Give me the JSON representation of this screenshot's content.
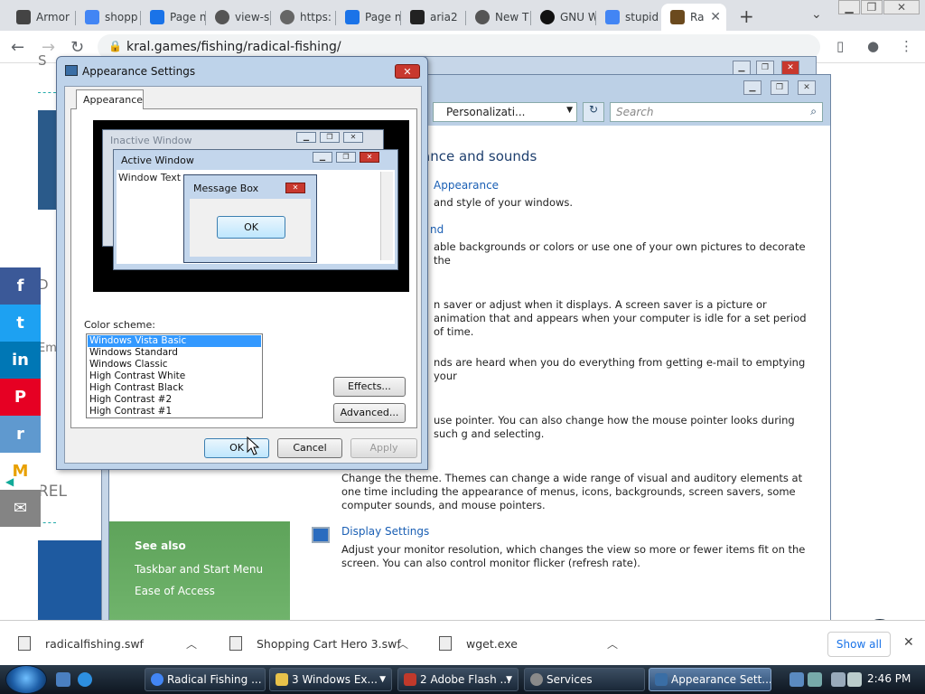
{
  "browser": {
    "tabs": [
      {
        "title": "Armor",
        "color": "#444"
      },
      {
        "title": "shopp",
        "color": "#4285f4"
      },
      {
        "title": "Page n",
        "color": "#1a73e8"
      },
      {
        "title": "view-s",
        "color": "#555"
      },
      {
        "title": "https:",
        "color": "#666"
      },
      {
        "title": "Page n",
        "color": "#1a73e8"
      },
      {
        "title": "aria2",
        "color": "#222"
      },
      {
        "title": "New T",
        "color": "#555"
      },
      {
        "title": "GNU W",
        "color": "#111"
      },
      {
        "title": "stupid",
        "color": "#4285f4"
      },
      {
        "title": "Ra",
        "color": "#6b4a1e",
        "active": true
      }
    ],
    "url": "kral.games/fishing/radical-fishing/"
  },
  "page": {
    "letter_s": "S",
    "letter_d": "D",
    "em_text": "Em",
    "rel_text": "REL",
    "social": [
      {
        "label": "f",
        "color": "#3b5998"
      },
      {
        "label": "t",
        "color": "#1da1f2"
      },
      {
        "label": "in",
        "color": "#0077b5"
      },
      {
        "label": "P",
        "color": "#e60023"
      },
      {
        "label": "r",
        "color": "#5f99cf"
      },
      {
        "label": "M",
        "color": "#ffffff"
      },
      {
        "label": "✉",
        "color": "#848484"
      }
    ]
  },
  "control_panel": {
    "address": "Personalizati...",
    "search_placeholder": "Search",
    "heading": "ance and sounds",
    "link_appearance": "Appearance",
    "text_appearance": "and style of your windows.",
    "link_desktop": "nd",
    "text_desktop": "able backgrounds or colors or use one of your own pictures to decorate the",
    "text_screensaver": "n saver or adjust when it displays. A screen saver is a picture or animation that and appears when your computer is idle for a set period of time.",
    "text_sounds": "nds are heard when you do everything from getting e-mail to emptying your",
    "text_mouse": "use pointer. You can also change how the mouse pointer looks during such g and selecting.",
    "text_theme": "Change the theme. Themes can change a wide range of visual and auditory elements at one time including the appearance of menus, icons, backgrounds, screen savers, some computer sounds, and mouse pointers.",
    "link_display": "Display Settings",
    "text_display": "Adjust your monitor resolution, which changes the view so more or fewer items fit on the screen. You can also control monitor flicker (refresh rate).",
    "see_also": "See also",
    "see_also_items": [
      "Taskbar and Start Menu",
      "Ease of Access"
    ]
  },
  "dialog": {
    "title": "Appearance Settings",
    "tab": "Appearance",
    "preview": {
      "inactive": "Inactive Window",
      "active": "Active Window",
      "window_text": "Window Text",
      "message_box": "Message Box",
      "ok": "OK"
    },
    "scheme_label": "Color scheme:",
    "schemes": [
      "Windows Vista Basic",
      "Windows Standard",
      "Windows Classic",
      "High Contrast White",
      "High Contrast Black",
      "High Contrast #2",
      "High Contrast #1"
    ],
    "selected_scheme": "Windows Vista Basic",
    "effects": "Effects...",
    "advanced": "Advanced...",
    "ok": "OK",
    "cancel": "Cancel",
    "apply": "Apply"
  },
  "downloads": [
    {
      "name": "radicalfishing.swf"
    },
    {
      "name": "Shopping Cart Hero 3.swf"
    },
    {
      "name": "wget.exe"
    }
  ],
  "downloads_show_all": "Show all",
  "taskbar": {
    "buttons": [
      {
        "label": "Radical Fishing ...",
        "color": "#4285f4"
      },
      {
        "label": "3 Windows Ex...",
        "color": "#e8c24a"
      },
      {
        "label": "2 Adobe Flash ...",
        "color": "#c0392b"
      },
      {
        "label": "Services",
        "color": "#8a8a8a"
      },
      {
        "label": "Appearance Sett...",
        "color": "#3a6ea5",
        "active": true
      }
    ],
    "clock": "2:46 PM"
  }
}
